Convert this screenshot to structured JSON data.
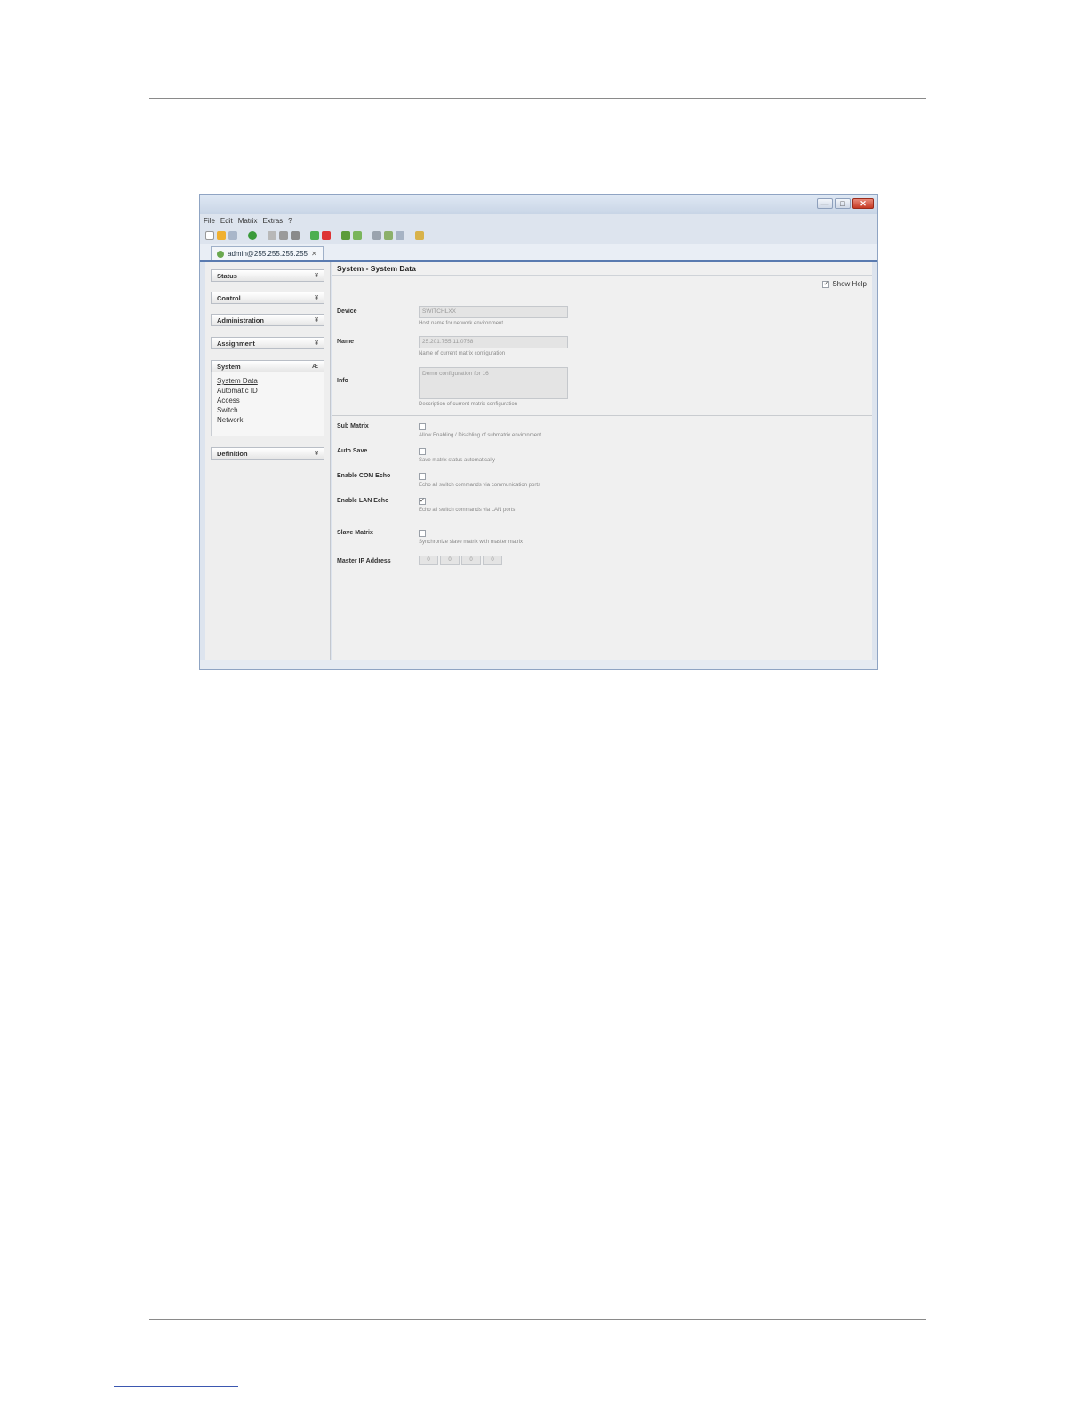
{
  "window": {
    "controls": {
      "minimize": "—",
      "maximize": "□",
      "close": "✕"
    }
  },
  "menu": [
    "File",
    "Edit",
    "Matrix",
    "Extras",
    "?"
  ],
  "tab": {
    "label": "admin@255.255.255.255",
    "close": "✕"
  },
  "sidebar": {
    "sections": [
      {
        "label": "Status",
        "chevron": "¥"
      },
      {
        "label": "Control",
        "chevron": "¥"
      },
      {
        "label": "Administration",
        "chevron": "¥"
      },
      {
        "label": "Assignment",
        "chevron": "¥"
      },
      {
        "label": "System",
        "chevron": "Æ"
      },
      {
        "label": "Definition",
        "chevron": "¥"
      }
    ],
    "system_items": [
      "System Data",
      "Automatic ID",
      "Access",
      "Switch",
      "Network"
    ]
  },
  "content": {
    "title": "System - System Data",
    "show_help": "Show Help",
    "fields": {
      "device": {
        "label": "Device",
        "value": "SWITCHLXX",
        "help": "Host name for network environment"
      },
      "name": {
        "label": "Name",
        "value": "25.201.755.11.0758",
        "help": "Name of current matrix configuration"
      },
      "info": {
        "label": "Info",
        "value": "Demo configuration for 16",
        "help": "Description of current matrix configuration"
      },
      "sub_matrix": {
        "label": "Sub Matrix",
        "help": "Allow Enabling / Disabling of submatrix environment"
      },
      "auto_save": {
        "label": "Auto Save",
        "help": "Save matrix status automatically"
      },
      "com_echo": {
        "label": "Enable COM Echo",
        "help": "Echo all switch commands via communication ports"
      },
      "lan_echo": {
        "label": "Enable LAN Echo",
        "help": "Echo all switch commands via LAN ports"
      },
      "slave_matrix": {
        "label": "Slave Matrix",
        "help": "Synchronize slave matrix with master matrix"
      },
      "master_ip": {
        "label": "Master IP Address",
        "octets": [
          "0",
          "0",
          "0",
          "0"
        ]
      }
    }
  }
}
